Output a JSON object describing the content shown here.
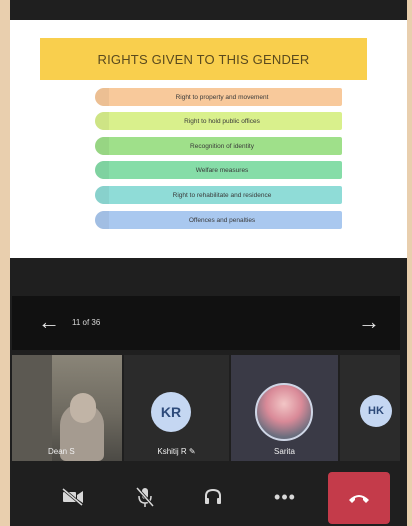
{
  "slide": {
    "title": "RIGHTS GIVEN TO THIS GENDER",
    "items": [
      {
        "label": "Right to property and movement",
        "color": "#f8c99b"
      },
      {
        "label": "Right to hold public offices",
        "color": "#d9f08c"
      },
      {
        "label": "Recognition of identity",
        "color": "#9fe08a"
      },
      {
        "label": "Welfare measures",
        "color": "#86dda8"
      },
      {
        "label": "Right to rehabilitate and residence",
        "color": "#8fdcd7"
      },
      {
        "label": "Offences and penalties",
        "color": "#a9c8ef"
      }
    ]
  },
  "slide_nav": {
    "counter": "11 of 36"
  },
  "participants": [
    {
      "name": "Dean S"
    },
    {
      "name": "Kshitij R ✎",
      "initials": "KR"
    },
    {
      "name": "Sarita"
    },
    {
      "initials": "HK"
    }
  ],
  "colors": {
    "end_call": "#c43b4a",
    "slide_title_bg": "#f9cf4d"
  },
  "toolbar_icons": [
    "video-off-icon",
    "mic-off-icon",
    "headset-icon",
    "more-icon",
    "hang-up-icon"
  ]
}
